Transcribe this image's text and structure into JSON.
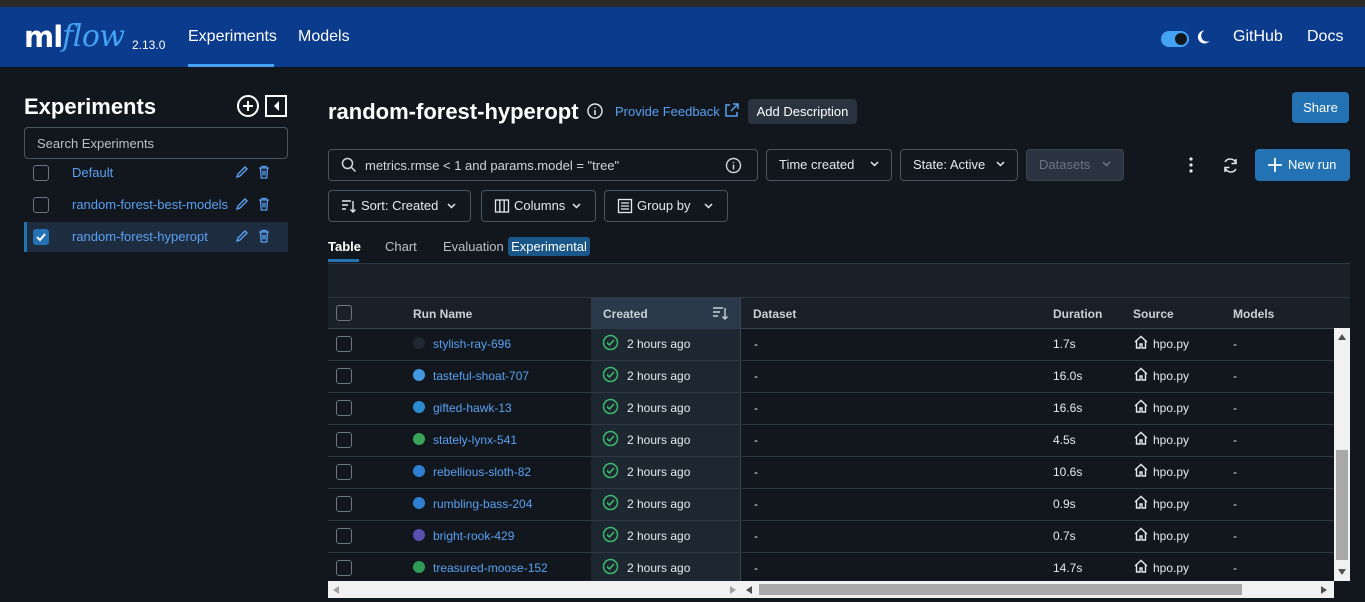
{
  "header": {
    "logo_ml": "ml",
    "logo_flow": "flow",
    "version": "2.13.0",
    "nav": {
      "experiments": "Experiments",
      "models": "Models",
      "github": "GitHub",
      "docs": "Docs"
    },
    "accent_color": "#44a3f5",
    "bg_color": "#0b3b8c"
  },
  "sidebar": {
    "title": "Experiments",
    "search_placeholder": "Search Experiments",
    "experiments": [
      {
        "label": "Default",
        "selected": false
      },
      {
        "label": "random-forest-best-models",
        "selected": false
      },
      {
        "label": "random-forest-hyperopt",
        "selected": true
      }
    ]
  },
  "main": {
    "title": "random-forest-hyperopt",
    "feedback_label": "Provide Feedback",
    "add_description_label": "Add Description",
    "share_label": "Share",
    "search_query": "metrics.rmse < 1 and params.model = \"tree\"",
    "time_created_label": "Time created",
    "state_label": "State: Active",
    "datasets_label": "Datasets",
    "new_run_label": "New run",
    "sort_label": "Sort: Created",
    "columns_label": "Columns",
    "group_by_label": "Group by",
    "tabs": {
      "table": "Table",
      "chart": "Chart",
      "evaluation": "Evaluation",
      "experimental_badge": "Experimental"
    },
    "table": {
      "columns": {
        "run_name": "Run Name",
        "created": "Created",
        "dataset": "Dataset",
        "duration": "Duration",
        "source": "Source",
        "models": "Models"
      },
      "rows": [
        {
          "name": "stylish-ray-696",
          "color": "#1f2733",
          "created": "2 hours ago",
          "dataset": "-",
          "duration": "1.7s",
          "source": "hpo.py",
          "models": "-"
        },
        {
          "name": "tasteful-shoat-707",
          "color": "#4299e1",
          "created": "2 hours ago",
          "dataset": "-",
          "duration": "16.0s",
          "source": "hpo.py",
          "models": "-"
        },
        {
          "name": "gifted-hawk-13",
          "color": "#2b8bd0",
          "created": "2 hours ago",
          "dataset": "-",
          "duration": "16.6s",
          "source": "hpo.py",
          "models": "-"
        },
        {
          "name": "stately-lynx-541",
          "color": "#3aa35a",
          "created": "2 hours ago",
          "dataset": "-",
          "duration": "4.5s",
          "source": "hpo.py",
          "models": "-"
        },
        {
          "name": "rebellious-sloth-82",
          "color": "#2f7fd0",
          "created": "2 hours ago",
          "dataset": "-",
          "duration": "10.6s",
          "source": "hpo.py",
          "models": "-"
        },
        {
          "name": "rumbling-bass-204",
          "color": "#2f7fd0",
          "created": "2 hours ago",
          "dataset": "-",
          "duration": "0.9s",
          "source": "hpo.py",
          "models": "-"
        },
        {
          "name": "bright-rook-429",
          "color": "#5b4fb0",
          "created": "2 hours ago",
          "dataset": "-",
          "duration": "0.7s",
          "source": "hpo.py",
          "models": "-"
        },
        {
          "name": "treasured-moose-152",
          "color": "#2e9a55",
          "created": "2 hours ago",
          "dataset": "-",
          "duration": "14.7s",
          "source": "hpo.py",
          "models": "-"
        }
      ]
    }
  }
}
